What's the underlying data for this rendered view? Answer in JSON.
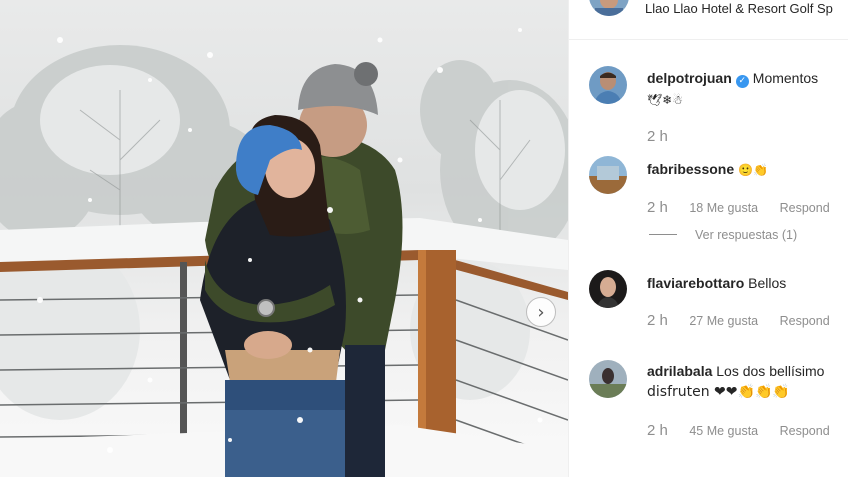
{
  "post": {
    "location": "Llao Llao Hotel & Resort Golf Sp",
    "next_icon": "chevron-right-icon"
  },
  "comments": [
    {
      "username": "delpotrojuan",
      "verified": true,
      "text": "Momentos",
      "emojis": "🕊❄☃",
      "time": "2 h"
    },
    {
      "username": "fabribessone",
      "text": "🙂👏",
      "time": "2 h",
      "likes": "18 Me gusta",
      "reply": "Respond",
      "view_replies": "Ver respuestas (1)"
    },
    {
      "username": "flaviarebottaro",
      "text": "Bellos",
      "time": "2 h",
      "likes": "27 Me gusta",
      "reply": "Respond"
    },
    {
      "username": "adrilabala",
      "text": "Los dos bellísimo",
      "text2": "disfruten ❤❤👏👏👏",
      "time": "2 h",
      "likes": "45 Me gusta",
      "reply": "Respond"
    }
  ],
  "colors": {
    "verified": "#3897f0",
    "muted": "#8e8e8e",
    "text": "#262626"
  }
}
